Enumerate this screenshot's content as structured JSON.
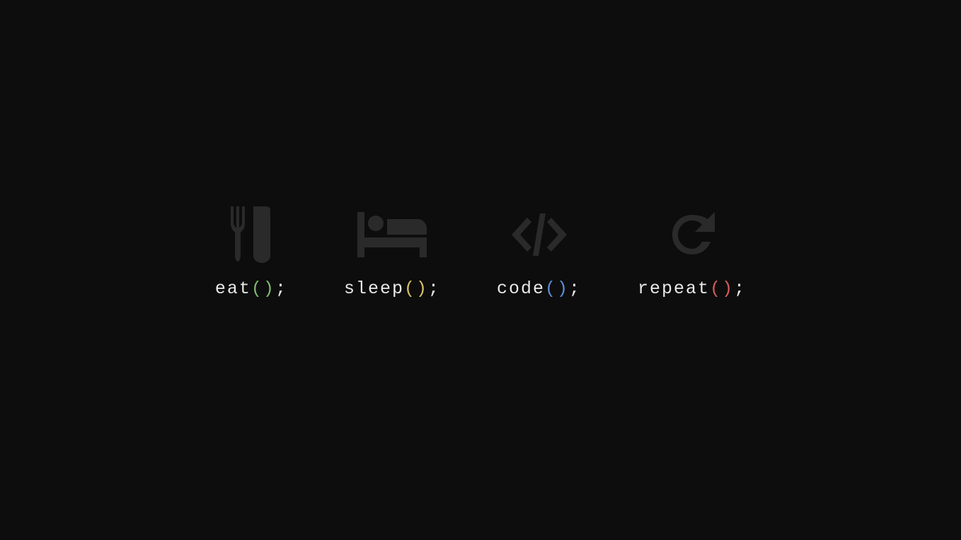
{
  "items": [
    {
      "name": "eat",
      "parens": "()",
      "semicolon": ";",
      "parensColor": "parens-green",
      "iconName": "eat-icon"
    },
    {
      "name": "sleep",
      "parens": "()",
      "semicolon": ";",
      "parensColor": "parens-yellow",
      "iconName": "sleep-icon"
    },
    {
      "name": "code",
      "parens": "()",
      "semicolon": ";",
      "parensColor": "parens-blue",
      "iconName": "code-icon"
    },
    {
      "name": "repeat",
      "parens": "()",
      "semicolon": ";",
      "parensColor": "parens-red",
      "iconName": "repeat-icon"
    }
  ]
}
